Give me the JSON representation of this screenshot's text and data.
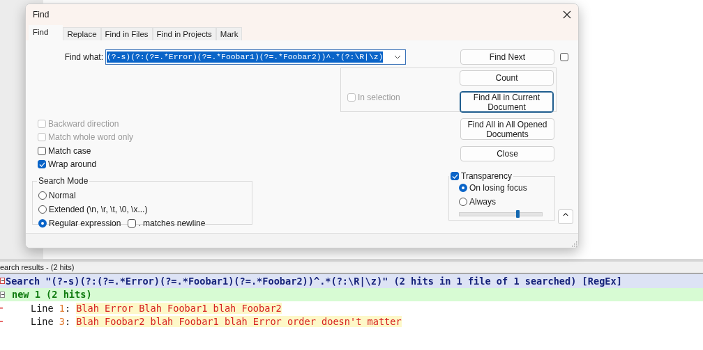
{
  "dialog": {
    "title": "Find",
    "tabs": [
      {
        "label": "Find",
        "selected": true
      },
      {
        "label": "Replace",
        "selected": false
      },
      {
        "label": "Find in Files",
        "selected": false
      },
      {
        "label": "Find in Projects",
        "selected": false
      },
      {
        "label": "Mark",
        "selected": false
      }
    ],
    "find_what": {
      "label": "Find what:",
      "value": "(?-s)(?:(?=.*Error)(?=.*Foobar1)(?=.*Foobar2))^.*(?:\\R|\\z)"
    },
    "find_next_checkbox": {
      "checked": false
    },
    "in_selection": {
      "label": "In selection",
      "checked": false,
      "disabled": true
    },
    "buttons": [
      {
        "label": "Find Next",
        "focused": false
      },
      {
        "label": "Count",
        "focused": false
      },
      {
        "label": "Find All in Current Document",
        "focused": true
      },
      {
        "label": "Find All in All Opened Documents",
        "focused": false
      },
      {
        "label": "Close",
        "focused": false
      }
    ],
    "options": [
      {
        "label": "Backward direction",
        "checked": false,
        "disabled": true
      },
      {
        "label": "Match whole word only",
        "checked": false,
        "disabled": true
      },
      {
        "label": "Match case",
        "checked": false,
        "disabled": false
      },
      {
        "label": "Wrap around",
        "checked": true,
        "disabled": false
      }
    ],
    "search_mode": {
      "title": "Search Mode",
      "modes": [
        {
          "label": "Normal",
          "selected": false
        },
        {
          "label": "Extended (\\n, \\r, \\t, \\0, \\x...)",
          "selected": false
        },
        {
          "label": "Regular expression",
          "selected": true
        }
      ],
      "dot_matches_newline": {
        "label": ". matches newline",
        "checked": false
      }
    },
    "transparency": {
      "label": "Transparency",
      "checked": true,
      "modes": [
        {
          "label": "On losing focus",
          "selected": true
        },
        {
          "label": "Always",
          "selected": false
        }
      ],
      "level": 0.71
    },
    "collapse_button": {
      "label": "^"
    }
  },
  "results": {
    "title": "earch results - (2 hits)",
    "search_line": "Search \"(?-s)(?:(?=.*Error)(?=.*Foobar1)(?=.*Foobar2))^.*(?:\\R|\\z)\" (2 hits in 1 file of 1 searched) [RegEx]",
    "file_line": "new 1 (2 hits)",
    "hits": [
      {
        "label": "Line",
        "number": "1",
        "separator": ":",
        "text": "Blah Error Blah Foobar1 blah Foobar2"
      },
      {
        "label": "Line",
        "number": "3",
        "separator": ":",
        "text": "Blah Foobar2 blah Foobar1 blah Error order doesn't matter"
      }
    ]
  }
}
